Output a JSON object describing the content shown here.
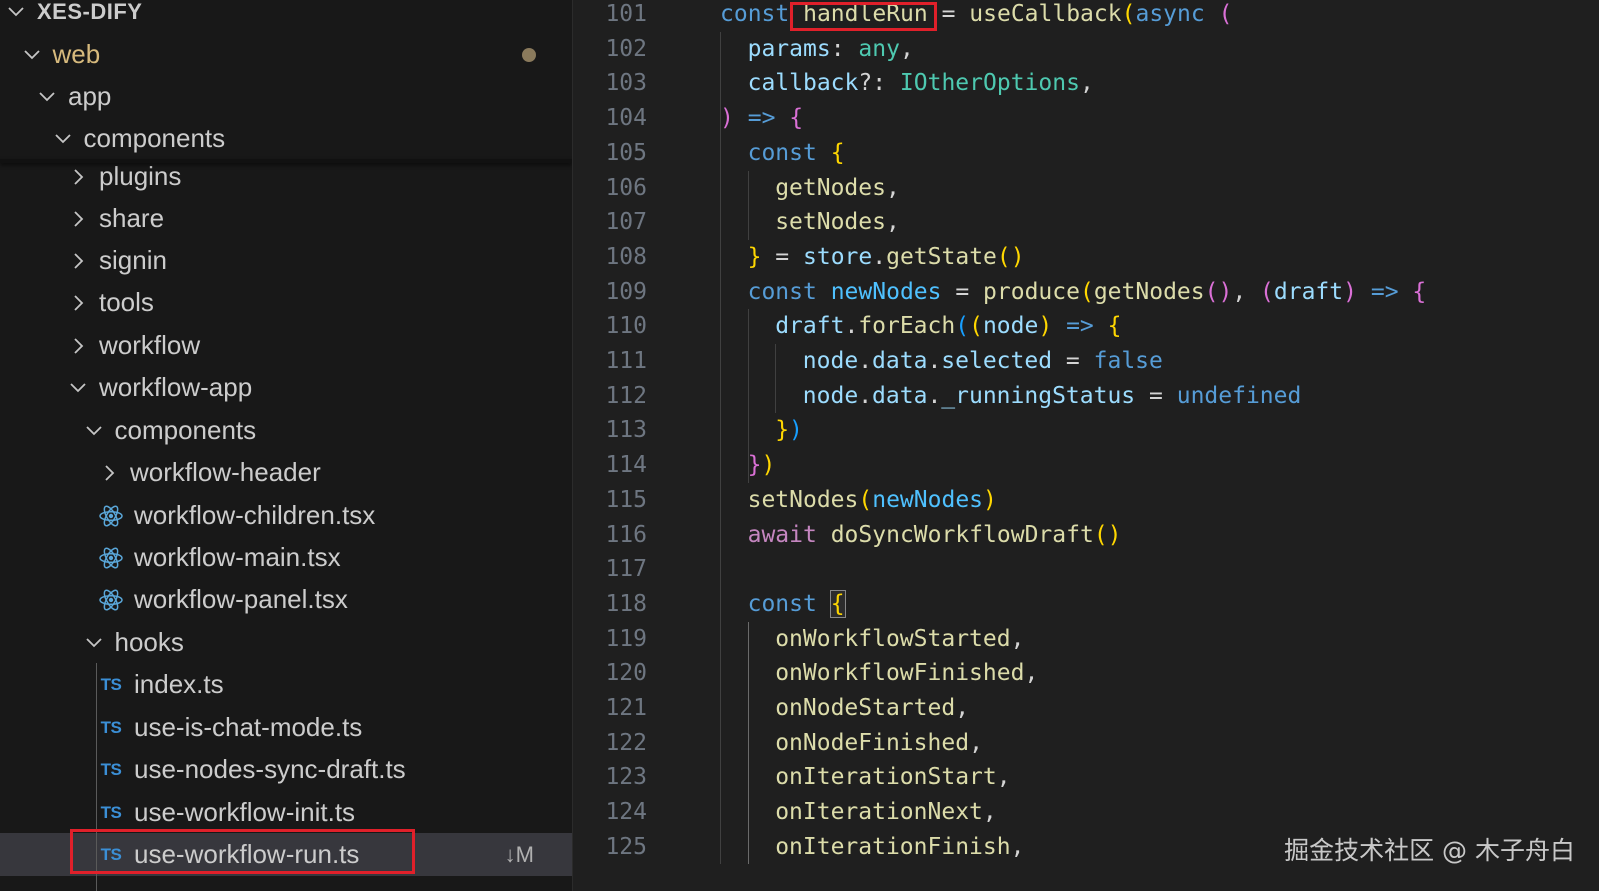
{
  "explorer": {
    "root": "XES-DIFY",
    "items": [
      {
        "label": "web",
        "kind": "folder-open",
        "modified": true
      },
      {
        "label": "app",
        "kind": "folder-open"
      },
      {
        "label": "components",
        "kind": "folder-open"
      },
      {
        "label": "plugins",
        "kind": "folder-closed"
      },
      {
        "label": "share",
        "kind": "folder-closed"
      },
      {
        "label": "signin",
        "kind": "folder-closed"
      },
      {
        "label": "tools",
        "kind": "folder-closed"
      },
      {
        "label": "workflow",
        "kind": "folder-closed"
      },
      {
        "label": "workflow-app",
        "kind": "folder-open"
      },
      {
        "label": "components",
        "kind": "folder-open"
      },
      {
        "label": "workflow-header",
        "kind": "folder-closed"
      },
      {
        "label": "workflow-children.tsx",
        "kind": "react-file"
      },
      {
        "label": "workflow-main.tsx",
        "kind": "react-file"
      },
      {
        "label": "workflow-panel.tsx",
        "kind": "react-file"
      },
      {
        "label": "hooks",
        "kind": "folder-open"
      },
      {
        "label": "index.ts",
        "kind": "ts-file"
      },
      {
        "label": "use-is-chat-mode.ts",
        "kind": "ts-file"
      },
      {
        "label": "use-nodes-sync-draft.ts",
        "kind": "ts-file"
      },
      {
        "label": "use-workflow-init.ts",
        "kind": "ts-file"
      },
      {
        "label": "use-workflow-run.ts",
        "kind": "ts-file",
        "selected": true,
        "git_status": "↓M"
      }
    ],
    "ts_icon_text": "TS"
  },
  "editor": {
    "line_numbers": [
      "101",
      "102",
      "103",
      "104",
      "105",
      "106",
      "107",
      "108",
      "109",
      "110",
      "111",
      "112",
      "113",
      "114",
      "115",
      "116",
      "117",
      "118",
      "119",
      "120",
      "121",
      "122",
      "123",
      "124",
      "125"
    ],
    "lines": [
      {
        "i": 0,
        "tokens": [
          [
            "const",
            "kw"
          ],
          [
            " ",
            "pl"
          ],
          [
            "handleRun",
            "fn"
          ],
          [
            " = ",
            "pl"
          ],
          [
            "useCallback",
            "fn"
          ],
          [
            "(",
            "b1"
          ],
          [
            "async",
            "kw"
          ],
          [
            " ",
            "pl"
          ],
          [
            "(",
            "b2"
          ]
        ]
      },
      {
        "i": 1,
        "tokens": [
          [
            "params",
            "var"
          ],
          [
            ": ",
            "pl"
          ],
          [
            "any",
            "ty"
          ],
          [
            ",",
            "pl"
          ]
        ]
      },
      {
        "i": 1,
        "tokens": [
          [
            "callback",
            "var"
          ],
          [
            "?: ",
            "pl"
          ],
          [
            "IOtherOptions",
            "ty"
          ],
          [
            ",",
            "pl"
          ]
        ]
      },
      {
        "i": 0,
        "tokens": [
          [
            ")",
            "b2"
          ],
          [
            " ",
            "pl"
          ],
          [
            "=>",
            "kw"
          ],
          [
            " ",
            "pl"
          ],
          [
            "{",
            "b2"
          ]
        ]
      },
      {
        "i": 1,
        "tokens": [
          [
            "const",
            "kw"
          ],
          [
            " ",
            "pl"
          ],
          [
            "{",
            "b1"
          ]
        ]
      },
      {
        "i": 2,
        "tokens": [
          [
            "getNodes",
            "fn"
          ],
          [
            ",",
            "pl"
          ]
        ]
      },
      {
        "i": 2,
        "tokens": [
          [
            "setNodes",
            "fn"
          ],
          [
            ",",
            "pl"
          ]
        ]
      },
      {
        "i": 1,
        "tokens": [
          [
            "}",
            "b1"
          ],
          [
            " = ",
            "pl"
          ],
          [
            "store",
            "var"
          ],
          [
            ".",
            "pl"
          ],
          [
            "getState",
            "fn"
          ],
          [
            "()",
            "b1"
          ]
        ]
      },
      {
        "i": 1,
        "tokens": [
          [
            "const",
            "kw"
          ],
          [
            " ",
            "pl"
          ],
          [
            "newNodes",
            "cn"
          ],
          [
            " = ",
            "pl"
          ],
          [
            "produce",
            "fn"
          ],
          [
            "(",
            "b1"
          ],
          [
            "getNodes",
            "fn"
          ],
          [
            "()",
            "b2"
          ],
          [
            ", ",
            "pl"
          ],
          [
            "(",
            "b2"
          ],
          [
            "draft",
            "var"
          ],
          [
            ")",
            "b2"
          ],
          [
            " ",
            "pl"
          ],
          [
            "=>",
            "kw"
          ],
          [
            " ",
            "pl"
          ],
          [
            "{",
            "b2"
          ]
        ]
      },
      {
        "i": 2,
        "tokens": [
          [
            "draft",
            "var"
          ],
          [
            ".",
            "pl"
          ],
          [
            "forEach",
            "fn"
          ],
          [
            "(",
            "b3"
          ],
          [
            "(",
            "b1"
          ],
          [
            "node",
            "var"
          ],
          [
            ")",
            "b1"
          ],
          [
            " ",
            "pl"
          ],
          [
            "=>",
            "kw"
          ],
          [
            " ",
            "pl"
          ],
          [
            "{",
            "b1"
          ]
        ]
      },
      {
        "i": 3,
        "tokens": [
          [
            "node",
            "var"
          ],
          [
            ".",
            "pl"
          ],
          [
            "data",
            "var"
          ],
          [
            ".",
            "pl"
          ],
          [
            "selected",
            "var"
          ],
          [
            " = ",
            "pl"
          ],
          [
            "false",
            "kw"
          ]
        ]
      },
      {
        "i": 3,
        "tokens": [
          [
            "node",
            "var"
          ],
          [
            ".",
            "pl"
          ],
          [
            "data",
            "var"
          ],
          [
            ".",
            "pl"
          ],
          [
            "_runningStatus",
            "var"
          ],
          [
            " = ",
            "pl"
          ],
          [
            "undefined",
            "kw"
          ]
        ]
      },
      {
        "i": 2,
        "tokens": [
          [
            "}",
            "b1"
          ],
          [
            ")",
            "b3"
          ]
        ]
      },
      {
        "i": 1,
        "tokens": [
          [
            "}",
            "b2"
          ],
          [
            ")",
            "b1"
          ]
        ]
      },
      {
        "i": 1,
        "tokens": [
          [
            "setNodes",
            "fn"
          ],
          [
            "(",
            "b1"
          ],
          [
            "newNodes",
            "cn"
          ],
          [
            ")",
            "b1"
          ]
        ]
      },
      {
        "i": 1,
        "tokens": [
          [
            "await",
            "ctl"
          ],
          [
            " ",
            "pl"
          ],
          [
            "doSyncWorkflowDraft",
            "fn"
          ],
          [
            "()",
            "b1"
          ]
        ]
      },
      {
        "i": 0,
        "tokens": []
      },
      {
        "i": 1,
        "tokens": [
          [
            "const",
            "kw"
          ],
          [
            " ",
            "pl"
          ],
          [
            "{",
            "b1"
          ]
        ]
      },
      {
        "i": 2,
        "tokens": [
          [
            "onWorkflowStarted",
            "fn"
          ],
          [
            ",",
            "pl"
          ]
        ]
      },
      {
        "i": 2,
        "tokens": [
          [
            "onWorkflowFinished",
            "fn"
          ],
          [
            ",",
            "pl"
          ]
        ]
      },
      {
        "i": 2,
        "tokens": [
          [
            "onNodeStarted",
            "fn"
          ],
          [
            ",",
            "pl"
          ]
        ]
      },
      {
        "i": 2,
        "tokens": [
          [
            "onNodeFinished",
            "fn"
          ],
          [
            ",",
            "pl"
          ]
        ]
      },
      {
        "i": 2,
        "tokens": [
          [
            "onIterationStart",
            "fn"
          ],
          [
            ",",
            "pl"
          ]
        ]
      },
      {
        "i": 2,
        "tokens": [
          [
            "onIterationNext",
            "fn"
          ],
          [
            ",",
            "pl"
          ]
        ]
      },
      {
        "i": 2,
        "tokens": [
          [
            "onIterationFinish",
            "fn"
          ],
          [
            ",",
            "pl"
          ]
        ]
      }
    ]
  },
  "watermark": "掘金技术社区 @ 木子舟白",
  "colors": {
    "highlight_border": "#e0202a",
    "modified_folder": "#d7ba7d",
    "ts_icon": "#3b8fd6",
    "react_icon": "#5aa7d9",
    "keyword": "#569cd6",
    "function": "#dcdcaa",
    "variable": "#9cdcfe",
    "type": "#4ec9b0"
  }
}
